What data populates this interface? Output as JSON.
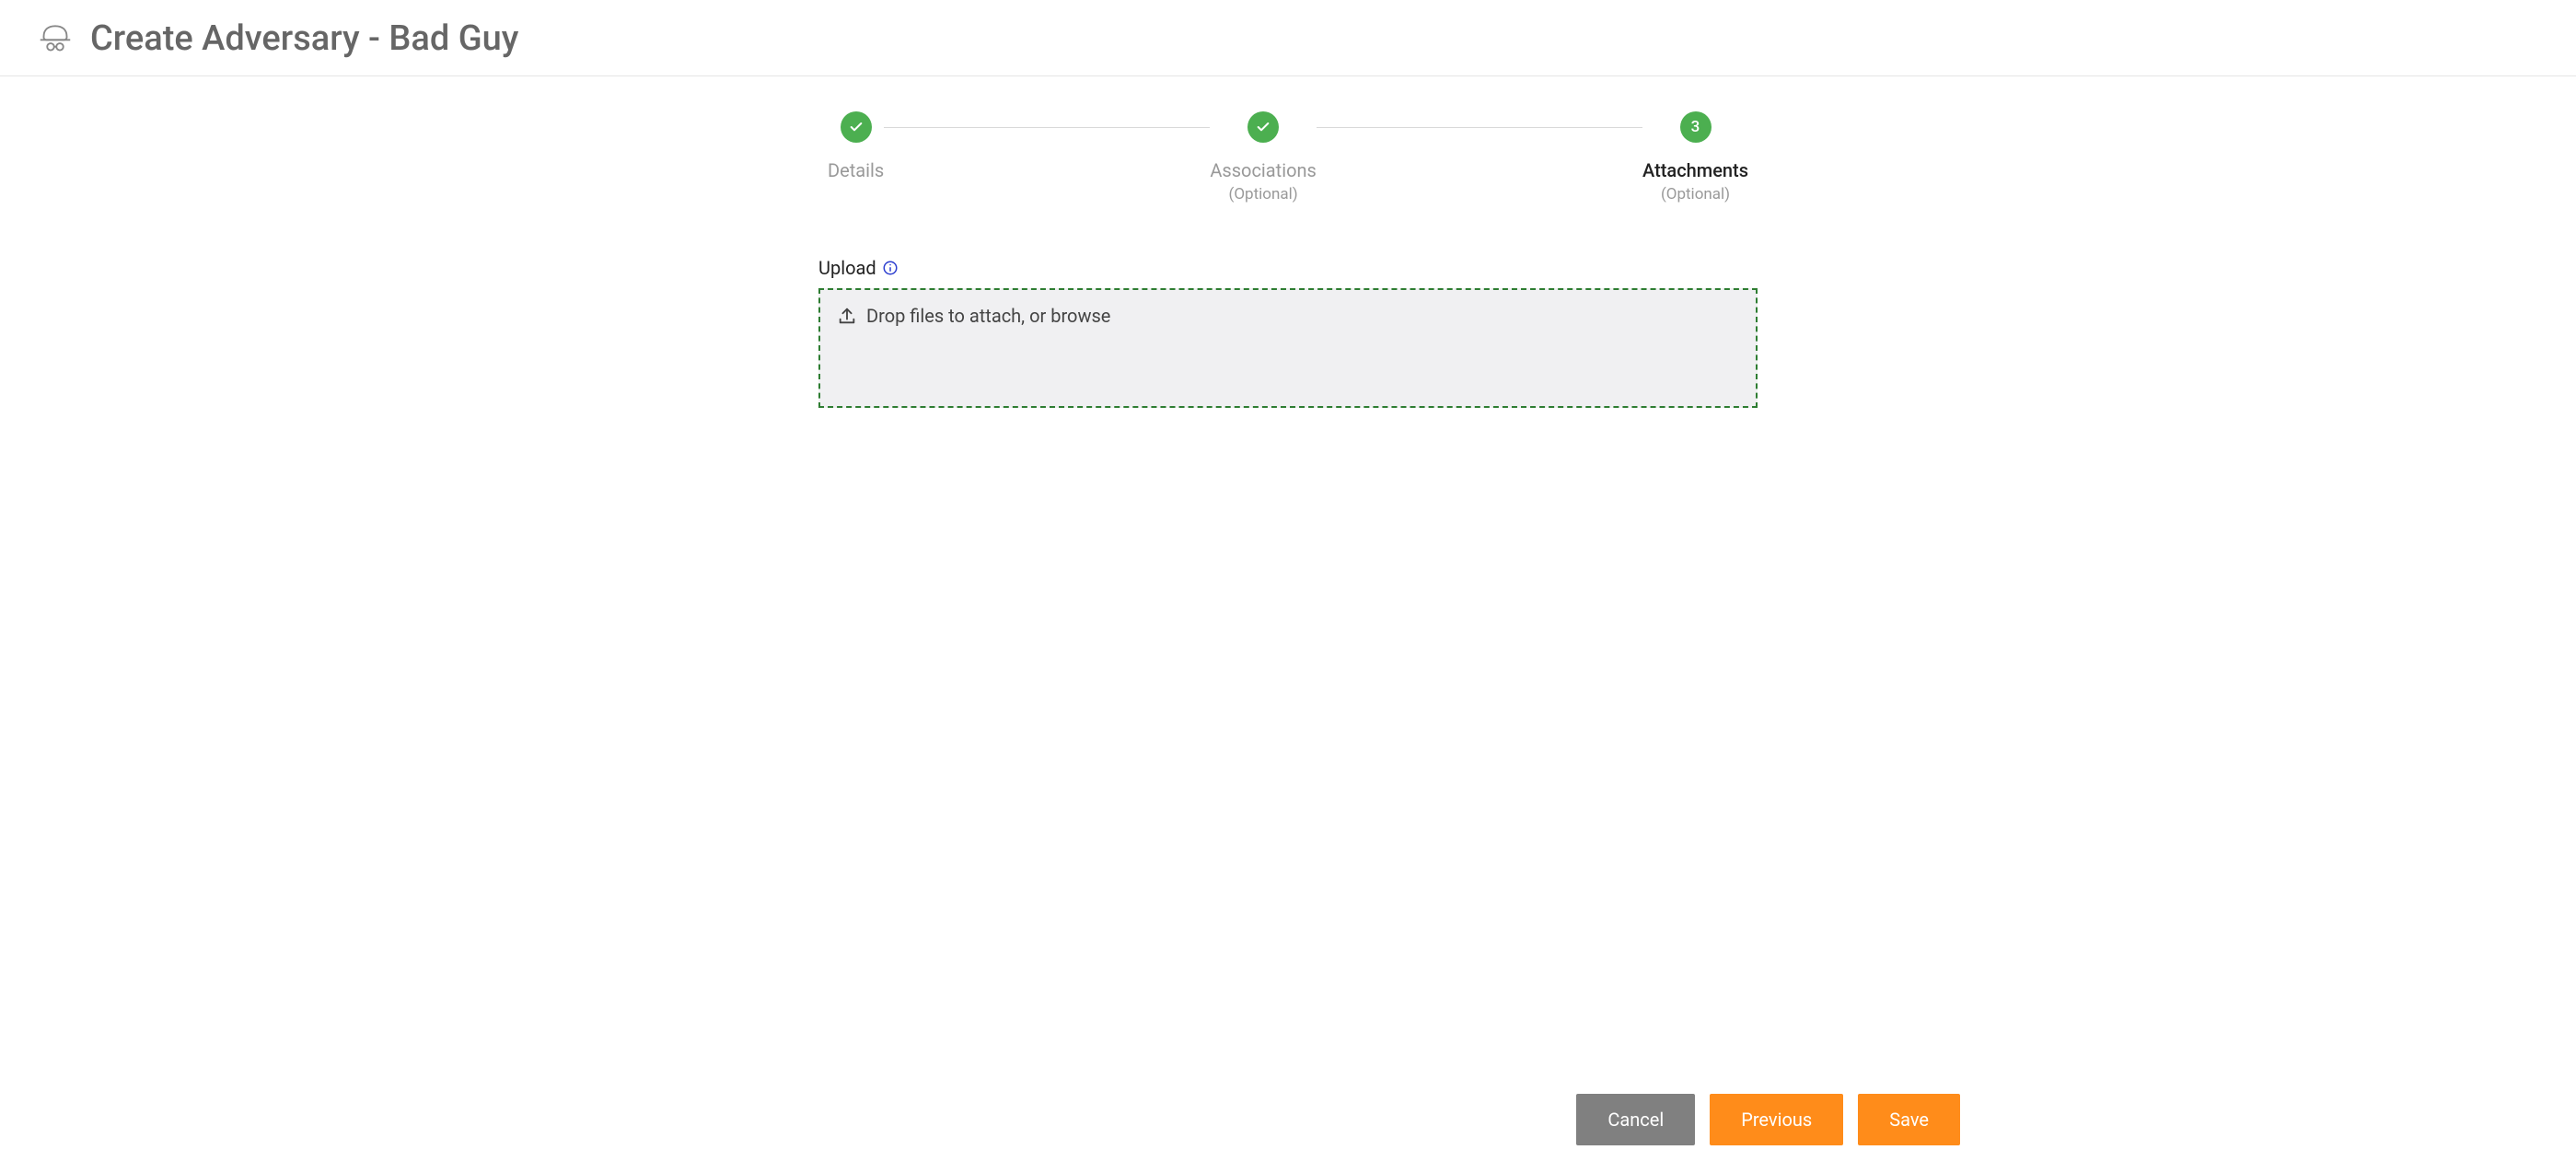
{
  "header": {
    "title": "Create Adversary - Bad Guy"
  },
  "stepper": {
    "steps": [
      {
        "label": "Details",
        "sub": "",
        "state": "done"
      },
      {
        "label": "Associations",
        "sub": "(Optional)",
        "state": "done"
      },
      {
        "label": "Attachments",
        "sub": "(Optional)",
        "state": "active",
        "number": "3"
      }
    ]
  },
  "upload": {
    "label": "Upload",
    "dropzone_text": "Drop files to attach, or browse"
  },
  "buttons": {
    "cancel": "Cancel",
    "previous": "Previous",
    "save": "Save"
  }
}
